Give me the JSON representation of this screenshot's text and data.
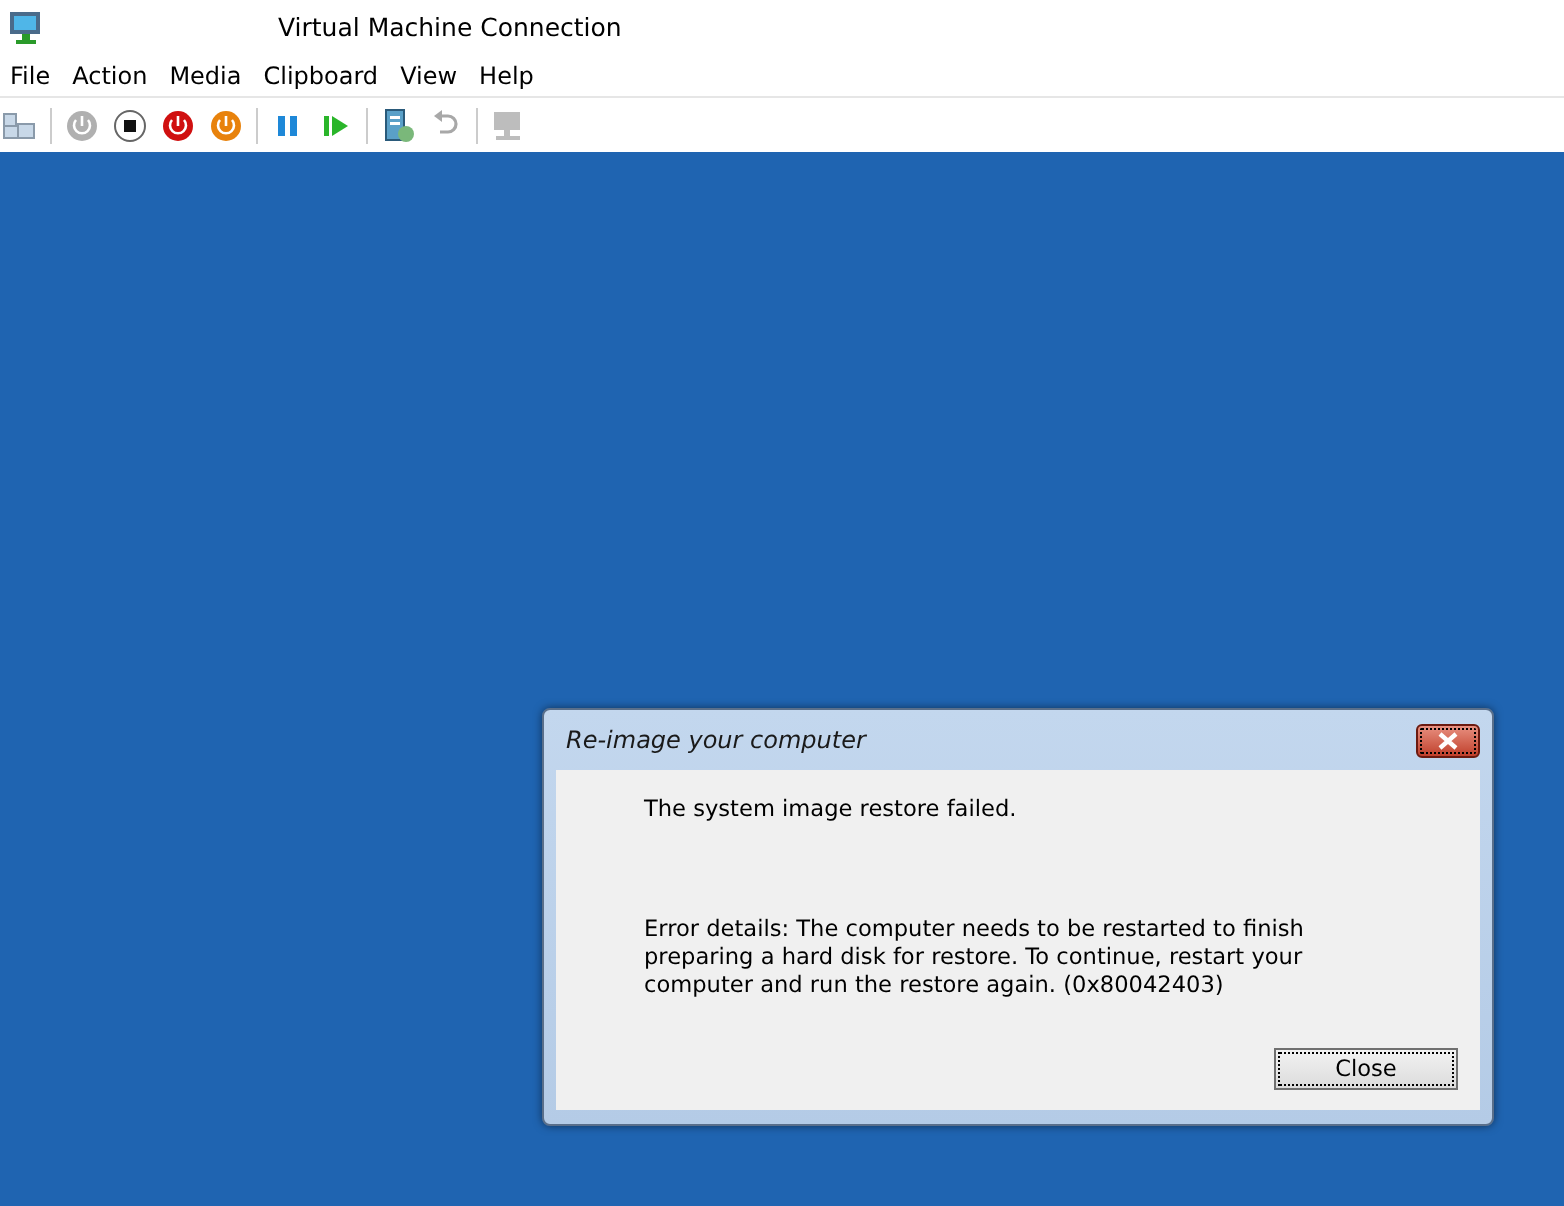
{
  "window": {
    "title": "Virtual Machine Connection"
  },
  "menu": [
    "File",
    "Action",
    "Media",
    "Clipboard",
    "View",
    "Help"
  ],
  "toolbar": [
    {
      "kind": "ctrlaltdel",
      "disabled": false
    },
    {
      "kind": "separator"
    },
    {
      "kind": "start",
      "disabled": true
    },
    {
      "kind": "turnoff",
      "disabled": false
    },
    {
      "kind": "shutdown",
      "disabled": false
    },
    {
      "kind": "save",
      "disabled": false
    },
    {
      "kind": "separator"
    },
    {
      "kind": "pause",
      "disabled": false
    },
    {
      "kind": "resume",
      "disabled": false
    },
    {
      "kind": "separator"
    },
    {
      "kind": "checkpoint",
      "disabled": false
    },
    {
      "kind": "revert",
      "disabled": true
    },
    {
      "kind": "separator"
    },
    {
      "kind": "enhanced",
      "disabled": true
    }
  ],
  "dialog": {
    "title": "Re-image your computer",
    "message": "The system image restore failed.",
    "details": "Error details: The computer needs to be restarted to finish preparing a hard disk for restore. To continue, restart your computer and run the restore again. (0x80042403)",
    "button": "Close"
  }
}
